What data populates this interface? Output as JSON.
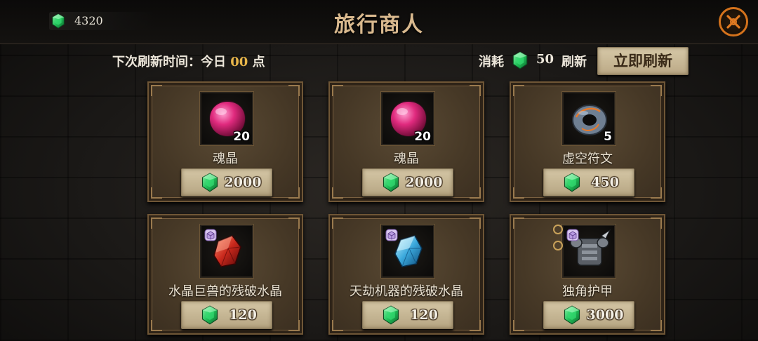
{
  "header": {
    "title": "旅行商人",
    "currency_amount": "4320",
    "currency_icon": "emerald-gem-icon",
    "close_icon": "close-icon"
  },
  "refresh": {
    "prefix": "下次刷新时间：",
    "day": "今日",
    "hour": "00",
    "suffix": "点",
    "cost_label": "消耗",
    "cost_amount": "50",
    "refresh_label": "刷新",
    "button_label": "立即刷新"
  },
  "items": [
    {
      "name": "魂晶",
      "quantity": "20",
      "price": "2000",
      "icon": "soul-crystal-icon"
    },
    {
      "name": "魂晶",
      "quantity": "20",
      "price": "2000",
      "icon": "soul-crystal-icon"
    },
    {
      "name": "虚空符文",
      "quantity": "5",
      "price": "450",
      "icon": "void-rune-icon"
    },
    {
      "name": "水晶巨兽的残破水晶",
      "quantity": "",
      "price": "120",
      "icon": "red-crystal-icon"
    },
    {
      "name": "天劫机器的残破水晶",
      "quantity": "",
      "price": "120",
      "icon": "blue-crystal-icon"
    },
    {
      "name": "独角护甲",
      "quantity": "",
      "price": "3000",
      "icon": "armor-icon"
    }
  ],
  "colors": {
    "accent_gold": "#e8b64a",
    "title": "#d9b98e",
    "close_ring": "#d4721c",
    "gem_green": "#2fcf6a"
  }
}
